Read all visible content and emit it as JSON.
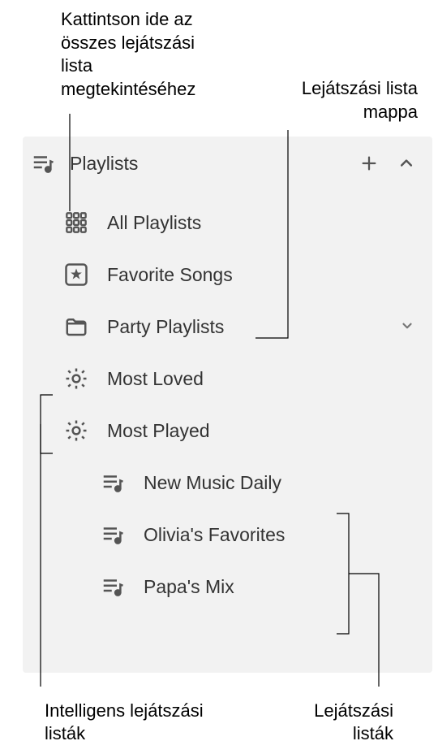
{
  "callouts": {
    "top_left": "Kattintson ide az összes lejátszási lista megtekintéséhez",
    "top_right": "Lejátszási lista mappa",
    "bottom_left": "Intelligens lejátszási listák",
    "bottom_right": "Lejátszási listák"
  },
  "sidebar": {
    "header_title": "Playlists",
    "items": [
      {
        "label": "All Playlists",
        "icon": "grid-icon"
      },
      {
        "label": "Favorite Songs",
        "icon": "star-box-icon"
      },
      {
        "label": "Party Playlists",
        "icon": "folder-icon",
        "has_chevron": true
      }
    ],
    "smart_playlists": [
      {
        "label": "Most Loved",
        "icon": "gear-icon"
      },
      {
        "label": "Most Played",
        "icon": "gear-icon"
      }
    ],
    "playlists": [
      {
        "label": "New Music Daily",
        "icon": "playlist-icon"
      },
      {
        "label": "Olivia's Favorites",
        "icon": "playlist-icon"
      },
      {
        "label": "Papa's Mix",
        "icon": "playlist-icon"
      }
    ]
  }
}
